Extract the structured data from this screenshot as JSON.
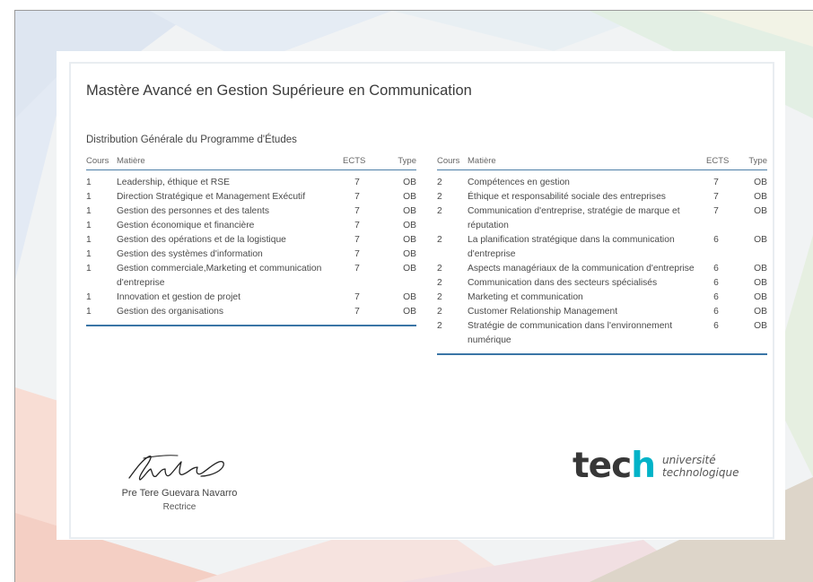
{
  "certificate": {
    "title": "Mastère Avancé en Gestion Supérieure en Communication",
    "section_title": "Distribution Générale du Programme d'Études"
  },
  "columns": {
    "course": "Cours",
    "subject": "Matière",
    "ects": "ECTS",
    "type": "Type"
  },
  "left_table": [
    {
      "course": "1",
      "subject": "Leadership, éthique et RSE",
      "ects": "7",
      "type": "OB"
    },
    {
      "course": "1",
      "subject": "Direction Stratégique et Management Exécutif",
      "ects": "7",
      "type": "OB"
    },
    {
      "course": "1",
      "subject": "Gestion des personnes et des talents",
      "ects": "7",
      "type": "OB"
    },
    {
      "course": "1",
      "subject": "Gestion économique et financière",
      "ects": "7",
      "type": "OB"
    },
    {
      "course": "1",
      "subject": "Gestion des opérations et de la logistique",
      "ects": "7",
      "type": "OB"
    },
    {
      "course": "1",
      "subject": "Gestion des systèmes d'information",
      "ects": "7",
      "type": "OB"
    },
    {
      "course": "1",
      "subject": "Gestion commerciale,Marketing et communication d'entreprise",
      "ects": "7",
      "type": "OB"
    },
    {
      "course": "1",
      "subject": "Innovation et gestion de projet",
      "ects": "7",
      "type": "OB"
    },
    {
      "course": "1",
      "subject": "Gestion des organisations",
      "ects": "7",
      "type": "OB"
    }
  ],
  "right_table": [
    {
      "course": "2",
      "subject": "Compétences en gestion",
      "ects": "7",
      "type": "OB"
    },
    {
      "course": "2",
      "subject": "Éthique et responsabilité sociale des entreprises",
      "ects": "7",
      "type": "OB"
    },
    {
      "course": "2",
      "subject": "Communication d'entreprise, stratégie de marque et réputation",
      "ects": "7",
      "type": "OB"
    },
    {
      "course": "2",
      "subject": "La planification stratégique dans la communication d'entreprise",
      "ects": "6",
      "type": "OB"
    },
    {
      "course": "2",
      "subject": "Aspects managériaux de la communication d'entreprise",
      "ects": "6",
      "type": "OB"
    },
    {
      "course": "2",
      "subject": "Communication dans des secteurs spécialisés",
      "ects": "6",
      "type": "OB"
    },
    {
      "course": "2",
      "subject": "Marketing et communication",
      "ects": "6",
      "type": "OB"
    },
    {
      "course": "2",
      "subject": "Customer Relationship Management",
      "ects": "6",
      "type": "OB"
    },
    {
      "course": "2",
      "subject": "Stratégie de communication dans l'environnement numérique",
      "ects": "6",
      "type": "OB"
    }
  ],
  "signer": {
    "name": "Pre Tere Guevara Navarro",
    "role": "Rectrice"
  },
  "logo": {
    "word_main": "tec",
    "word_accent": "h",
    "line1": "université",
    "line2": "technologique"
  },
  "colors": {
    "table_rule": "#3a75a6",
    "logo_accent": "#00b3c8",
    "logo_text": "#373737"
  }
}
